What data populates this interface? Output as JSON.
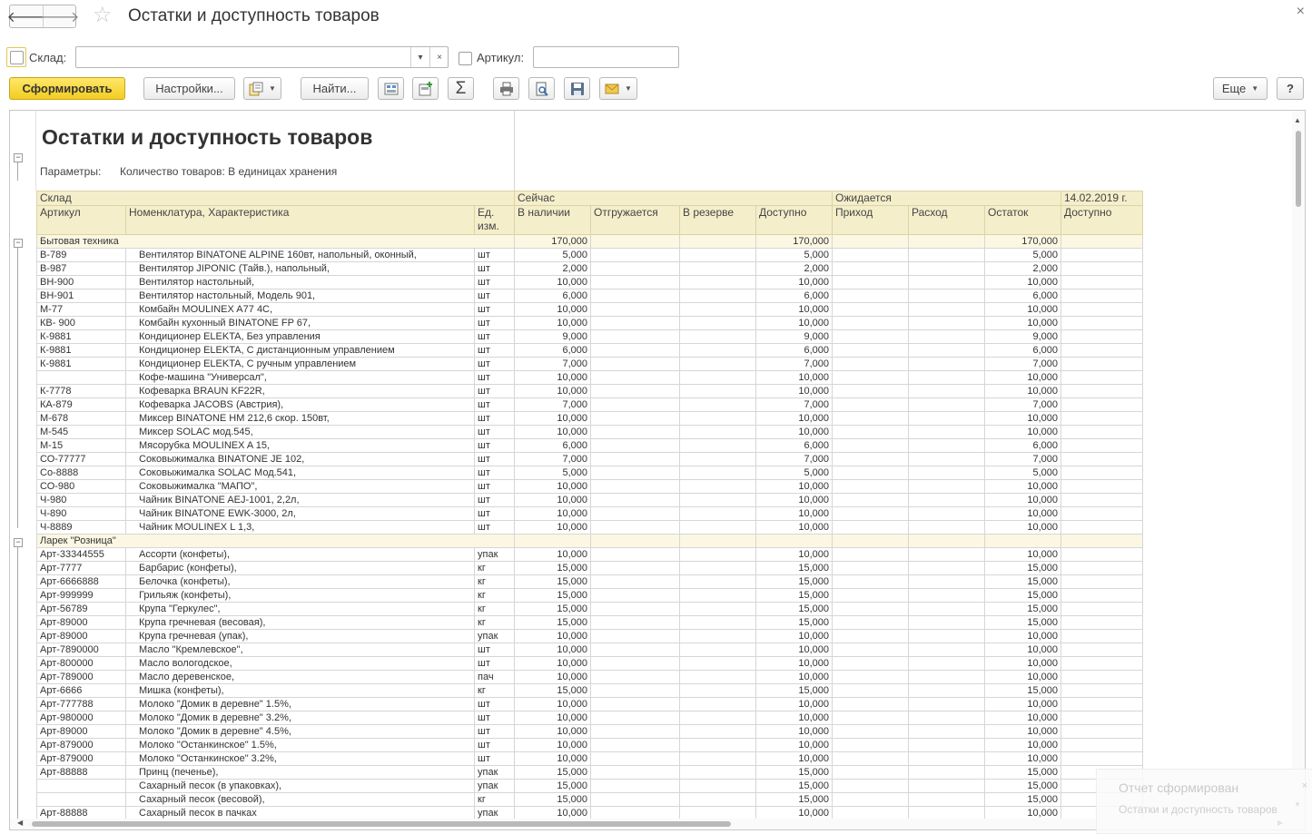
{
  "window": {
    "title": "Остатки и доступность товаров",
    "close": "×"
  },
  "nav": {
    "back": "🡐",
    "forward": "🡒",
    "favorite": "☆"
  },
  "filters": {
    "warehouse_label": "Склад:",
    "warehouse_value": "",
    "dropdown_icon": "▾",
    "clear_icon": "×",
    "article_label": "Артикул:",
    "article_value": ""
  },
  "toolbar": {
    "generate": "Сформировать",
    "settings": "Настройки...",
    "find": "Найти...",
    "sum_symbol": "Σ",
    "more": "Еще",
    "help": "?"
  },
  "report": {
    "title": "Остатки и доступность товаров",
    "params_label": "Параметры:",
    "params_value": "Количество товаров: В единицах хранения",
    "headers": {
      "warehouse": "Склад",
      "article": "Артикул",
      "nomenclature": "Номенклатура, Характеристика",
      "unit": "Ед. изм.",
      "now": "Сейчас",
      "on_hand": "В наличии",
      "shipping": "Отгружается",
      "reserved": "В резерве",
      "available": "Доступно",
      "expected": "Ожидается",
      "income": "Приход",
      "expense": "Расход",
      "remainder": "Остаток",
      "date": "14.02.2019 г.",
      "available_date": "Доступно"
    },
    "groups": [
      {
        "name": "Бытовая техника",
        "on_hand": "170,000",
        "available": "170,000",
        "remainder": "170,000",
        "rows": [
          [
            "В-789",
            "Вентилятор BINATONE ALPINE 160вт, напольный, оконный,",
            "шт",
            "5,000",
            "5,000",
            "5,000"
          ],
          [
            "В-987",
            "Вентилятор JIPONIC (Тайв.), напольный,",
            "шт",
            "2,000",
            "2,000",
            "2,000"
          ],
          [
            "ВН-900",
            "Вентилятор настольный,",
            "шт",
            "10,000",
            "10,000",
            "10,000"
          ],
          [
            "ВН-901",
            "Вентилятор настольный, Модель 901,",
            "шт",
            "6,000",
            "6,000",
            "6,000"
          ],
          [
            "М-77",
            "Комбайн MOULINEX  A77 4C,",
            "шт",
            "10,000",
            "10,000",
            "10,000"
          ],
          [
            "КВ- 900",
            "Комбайн кухонный BINATONE FP 67,",
            "шт",
            "10,000",
            "10,000",
            "10,000"
          ],
          [
            "К-9881",
            "Кондиционер ELEKTA, Без управления",
            "шт",
            "9,000",
            "9,000",
            "9,000"
          ],
          [
            "К-9881",
            "Кондиционер ELEKTA, С дистанционным управлением",
            "шт",
            "6,000",
            "6,000",
            "6,000"
          ],
          [
            "К-9881",
            "Кондиционер ELEKTA, С ручным управлением",
            "шт",
            "7,000",
            "7,000",
            "7,000"
          ],
          [
            "",
            "Кофе-машина \"Универсал\",",
            "шт",
            "10,000",
            "10,000",
            "10,000"
          ],
          [
            "К-7778",
            "Кофеварка BRAUN KF22R,",
            "шт",
            "10,000",
            "10,000",
            "10,000"
          ],
          [
            "КА-879",
            "Кофеварка JACOBS (Австрия),",
            "шт",
            "7,000",
            "7,000",
            "7,000"
          ],
          [
            "М-678",
            "Миксер BINATONE HM 212,6 скор. 150вт,",
            "шт",
            "10,000",
            "10,000",
            "10,000"
          ],
          [
            "М-545",
            "Миксер SOLAC мод.545,",
            "шт",
            "10,000",
            "10,000",
            "10,000"
          ],
          [
            "М-15",
            "Мясорубка MOULINEX  A 15,",
            "шт",
            "6,000",
            "6,000",
            "6,000"
          ],
          [
            "СО-77777",
            "Соковыжималка  BINATONE JE 102,",
            "шт",
            "7,000",
            "7,000",
            "7,000"
          ],
          [
            "Со-8888",
            "Соковыжималка  SOLAC  Мод.541,",
            "шт",
            "5,000",
            "5,000",
            "5,000"
          ],
          [
            "СО-980",
            "Соковыжималка \"МАПО\",",
            "шт",
            "10,000",
            "10,000",
            "10,000"
          ],
          [
            "Ч-980",
            "Чайник BINATONE  AEJ-1001,  2,2л,",
            "шт",
            "10,000",
            "10,000",
            "10,000"
          ],
          [
            "Ч-890",
            "Чайник BINATONE  EWK-3000,  2л,",
            "шт",
            "10,000",
            "10,000",
            "10,000"
          ],
          [
            "Ч-8889",
            "Чайник MOULINEX L 1,3,",
            "шт",
            "10,000",
            "10,000",
            "10,000"
          ]
        ]
      },
      {
        "name": "Ларек \"Розница\"",
        "on_hand": "",
        "available": "",
        "remainder": "",
        "rows": [
          [
            "Арт-33344555",
            "Ассорти (конфеты),",
            "упак",
            "10,000",
            "10,000",
            "10,000"
          ],
          [
            "Арт-7777",
            "Барбарис (конфеты),",
            "кг",
            "15,000",
            "15,000",
            "15,000"
          ],
          [
            "Арт-6666888",
            "Белочка (конфеты),",
            "кг",
            "15,000",
            "15,000",
            "15,000"
          ],
          [
            "Арт-999999",
            "Грильяж (конфеты),",
            "кг",
            "15,000",
            "15,000",
            "15,000"
          ],
          [
            "Арт-56789",
            "Крупа \"Геркулес\",",
            "кг",
            "15,000",
            "15,000",
            "15,000"
          ],
          [
            "Арт-89000",
            "Крупа гречневая (весовая),",
            "кг",
            "15,000",
            "15,000",
            "15,000"
          ],
          [
            "Арт-89000",
            "Крупа гречневая (упак),",
            "упак",
            "10,000",
            "10,000",
            "10,000"
          ],
          [
            "Арт-7890000",
            "Масло \"Кремлевское\",",
            "шт",
            "10,000",
            "10,000",
            "10,000"
          ],
          [
            "Арт-800000",
            "Масло вологодское,",
            "шт",
            "10,000",
            "10,000",
            "10,000"
          ],
          [
            "Арт-789000",
            "Масло деревенское,",
            "пач",
            "10,000",
            "10,000",
            "10,000"
          ],
          [
            "Арт-6666",
            "Мишка (конфеты),",
            "кг",
            "15,000",
            "15,000",
            "15,000"
          ],
          [
            "Арт-777788",
            "Молоко \"Домик в деревне\" 1.5%,",
            "шт",
            "10,000",
            "10,000",
            "10,000"
          ],
          [
            "Арт-980000",
            "Молоко \"Домик в деревне\" 3.2%,",
            "шт",
            "10,000",
            "10,000",
            "10,000"
          ],
          [
            "Арт-89000",
            "Молоко \"Домик в деревне\" 4.5%,",
            "шт",
            "10,000",
            "10,000",
            "10,000"
          ],
          [
            "Арт-879000",
            "Молоко \"Останкинское\" 1.5%,",
            "шт",
            "10,000",
            "10,000",
            "10,000"
          ],
          [
            "Арт-879000",
            "Молоко \"Останкинское\" 3.2%,",
            "шт",
            "10,000",
            "10,000",
            "10,000"
          ],
          [
            "Арт-88888",
            "Принц (печенье),",
            "упак",
            "15,000",
            "15,000",
            "15,000"
          ],
          [
            "",
            "Сахарный песок (в упаковках),",
            "упак",
            "15,000",
            "15,000",
            "15,000"
          ],
          [
            "",
            "Сахарный песок (весовой),",
            "кг",
            "15,000",
            "15,000",
            "15,000"
          ],
          [
            "Арт-88888",
            "Сахарный песок в пачках",
            "упак",
            "10,000",
            "10,000",
            "10,000"
          ]
        ]
      }
    ]
  },
  "toast": {
    "title": "Отчет сформирован",
    "text": "Остатки и доступность товаров",
    "close": "×"
  },
  "colors": {
    "header_bg": "#f5eecb",
    "group_bg": "#fbf7e2",
    "primary_button": "#f2cd20"
  }
}
